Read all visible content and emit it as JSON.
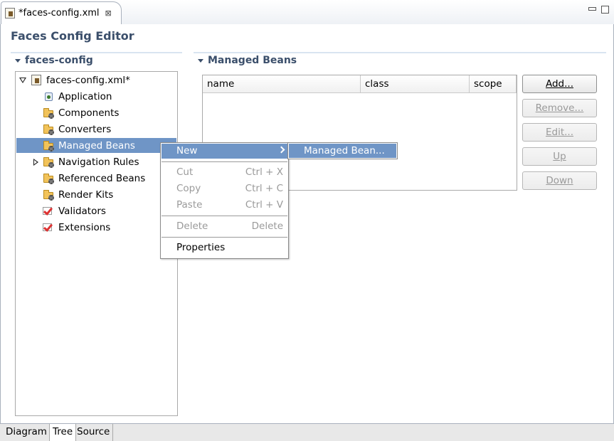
{
  "editor_tab": {
    "title": "*faces-config.xml",
    "close_glyph": "⊠"
  },
  "editor_title": "Faces Config Editor",
  "left_section": {
    "title": "faces-config"
  },
  "tree": {
    "root": "faces-config.xml*",
    "items": [
      {
        "label": "Application",
        "icon": "application-icon"
      },
      {
        "label": "Components",
        "icon": "folder-gear-icon"
      },
      {
        "label": "Converters",
        "icon": "folder-gear-icon"
      },
      {
        "label": "Managed Beans",
        "icon": "folder-gear-icon"
      },
      {
        "label": "Navigation Rules",
        "icon": "folder-gear-icon"
      },
      {
        "label": "Referenced Beans",
        "icon": "folder-gear-icon"
      },
      {
        "label": "Render Kits",
        "icon": "folder-gear-icon"
      },
      {
        "label": "Validators",
        "icon": "checkmark-icon"
      },
      {
        "label": "Extensions",
        "icon": "checkmark-icon"
      }
    ]
  },
  "right_section": {
    "title": "Managed Beans",
    "columns": [
      "name",
      "class",
      "scope"
    ],
    "buttons": {
      "add": "Add...",
      "remove": "Remove...",
      "edit": "Edit...",
      "up": "Up",
      "down": "Down"
    }
  },
  "context_menu": {
    "new": "New",
    "cut": "Cut",
    "cut_acc": "Ctrl + X",
    "copy": "Copy",
    "copy_acc": "Ctrl + C",
    "paste": "Paste",
    "paste_acc": "Ctrl + V",
    "delete": "Delete",
    "delete_acc": "Delete",
    "properties": "Properties"
  },
  "submenu": {
    "managed_bean": "Managed Bean..."
  },
  "page_tabs": [
    "Diagram",
    "Tree",
    "Source"
  ],
  "colors": {
    "selection": "#6f95c6",
    "section_title": "#3b4f6b"
  }
}
